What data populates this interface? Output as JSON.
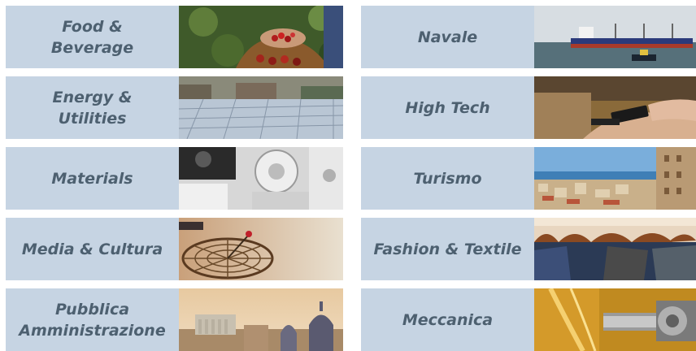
{
  "tiles": [
    {
      "id": "food-beverage",
      "label": "Food &\nBeverage",
      "icon": "coffee-harvest-photo"
    },
    {
      "id": "navale",
      "label": "Navale",
      "icon": "cargo-ship-photo"
    },
    {
      "id": "energy-utilities",
      "label": "Energy &\nUtilities",
      "icon": "solar-panels-photo"
    },
    {
      "id": "high-tech",
      "label": "High Tech",
      "icon": "smartphone-payment-photo"
    },
    {
      "id": "materials",
      "label": "Materials",
      "icon": "industrial-rollers-photo"
    },
    {
      "id": "turismo",
      "label": "Turismo",
      "icon": "coastal-city-photo"
    },
    {
      "id": "media-cultura",
      "label": "Media & Cultura",
      "icon": "satellite-dish-photo"
    },
    {
      "id": "fashion-textile",
      "label": "Fashion & Textile",
      "icon": "clothes-hangers-photo"
    },
    {
      "id": "pubblica-amministrazione",
      "label": "Pubblica\nAmministrazione",
      "icon": "rome-skyline-photo"
    },
    {
      "id": "meccanica",
      "label": "Meccanica",
      "icon": "machining-tool-photo"
    }
  ]
}
